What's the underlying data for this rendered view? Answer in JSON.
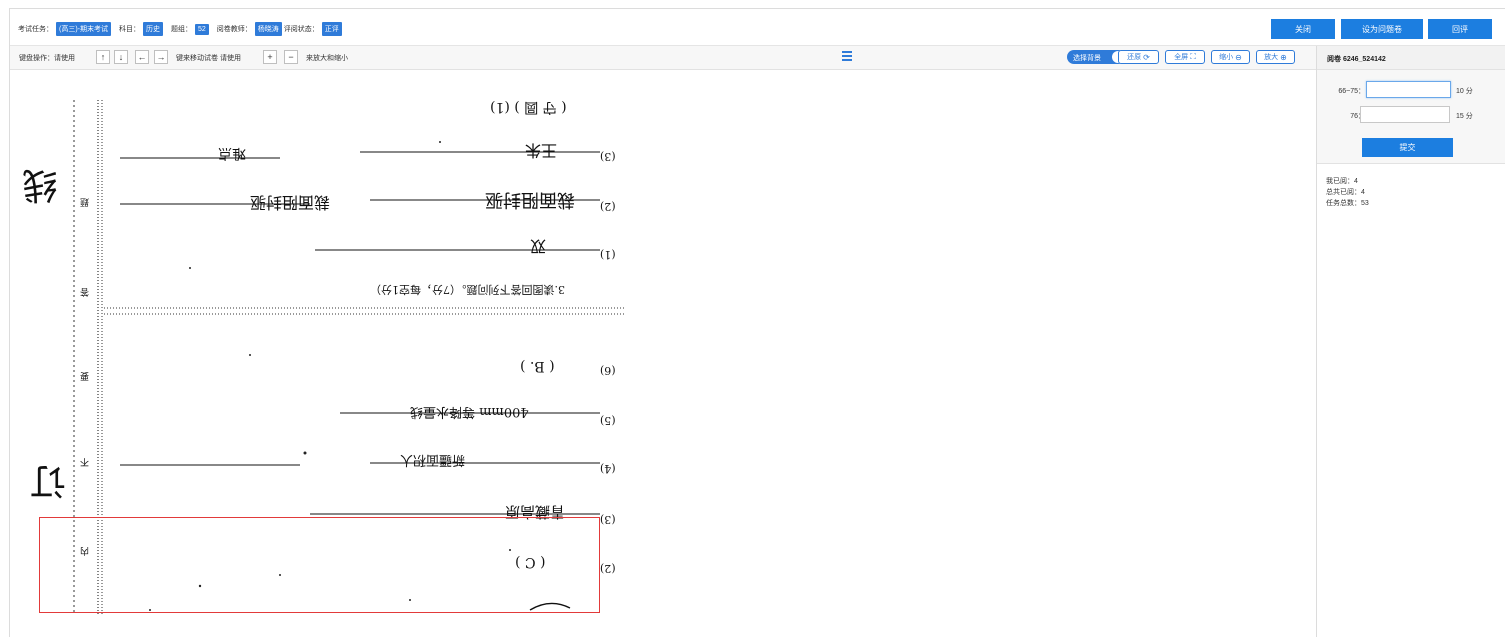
{
  "topbar": {
    "task_label": "考试任务：",
    "task_value": "(高三)-期末考试",
    "subject_label": "科目：",
    "subject_value": "历史",
    "group_label": "题组：",
    "group_value": "52",
    "teacher_label": "阅卷教师：",
    "teacher_value": "杨晓涛",
    "status_label": "评阅状态：",
    "status_value": "正评",
    "buttons": {
      "close": "关闭",
      "problem": "设为问题卷",
      "review": "回评"
    }
  },
  "toolbar": {
    "keyboard_label": "键盘操作：请使用",
    "arrows": [
      "↑",
      "↓",
      "←",
      "→"
    ],
    "move_text": "键来移动试卷  请使用",
    "plus": "+",
    "minus": "−",
    "zoom_text": "来放大和缩小",
    "toggle_label": "选择背景",
    "restore": "还原",
    "fullscreen": "全屏",
    "shrink": "缩小",
    "enlarge": "放大"
  },
  "panel": {
    "title": "阅卷 6246_524142",
    "scores": [
      {
        "label": "66~75：",
        "value": "",
        "unit": "10 分"
      },
      {
        "label": "76：",
        "value": "",
        "unit": "15 分"
      }
    ],
    "submit": "提交",
    "stats": {
      "my_read": "我已阅：4",
      "total_read": "总共已阅：4",
      "task_total": "任务总数：53"
    }
  },
  "paper": {
    "binding_labels": [
      "线",
      "订"
    ],
    "margin_labels": [
      "题",
      "答",
      "要",
      "不",
      "内"
    ],
    "question_title": "3.读图回答下列问题。（7分，每空1分）",
    "answers": [
      {
        "num": "(1)",
        "text": "( 守 圆 ) (1)"
      },
      {
        "num": "(3)",
        "text": "王朱"
      },
      {
        "num": "(2)",
        "text": "裁面阻封驱"
      },
      {
        "num": "(1)",
        "text": "双"
      },
      {
        "num": "(6)",
        "text": "( B. )"
      },
      {
        "num": "(5)",
        "text": "400mm 等降水量线"
      },
      {
        "num": "(4)",
        "text": ""
      },
      {
        "num": "(3)",
        "text": "青藏高原"
      },
      {
        "num": "(2)",
        "text": "( C )"
      }
    ],
    "extra_text": {
      "roads": "难点",
      "fields": "新疆面积大"
    }
  }
}
